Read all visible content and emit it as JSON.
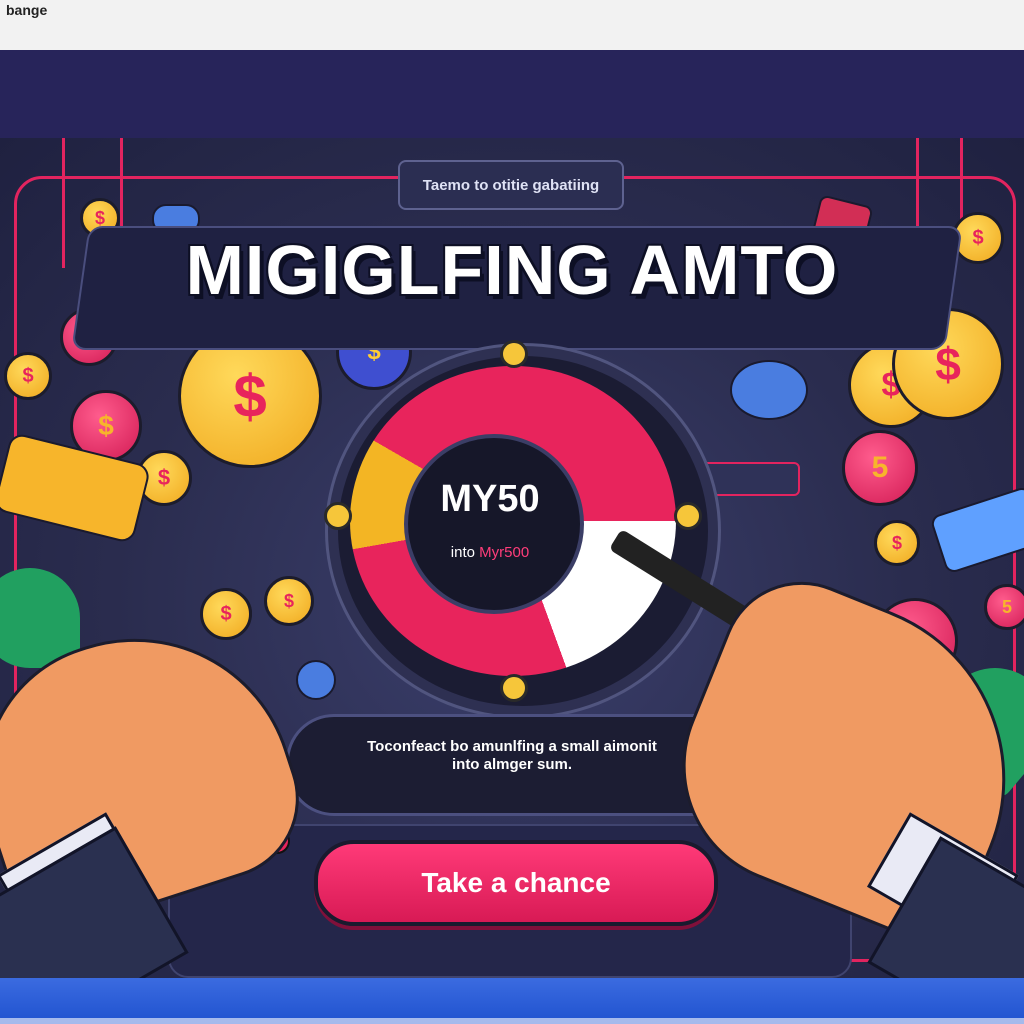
{
  "app": {
    "brand": "bange"
  },
  "hero": {
    "kicker": "Taemo to otitie gabatiing",
    "headline": "MIGIGLFING AMTO"
  },
  "wheel": {
    "amount": "MY50",
    "sub_prefix": "into ",
    "sub_highlight": "Myr500"
  },
  "info": {
    "line1": "Toconfeact bo amunlfing a small aimonit",
    "line2": "into almger sum."
  },
  "cta": {
    "label": "Take a chance"
  },
  "decor": {
    "coin_symbol": "$",
    "coin_five": "5",
    "coin_icon": "coin-icon",
    "colors": {
      "accent": "#e8245c",
      "gold": "#f3b524",
      "background": "#2a2c4e",
      "footer": "#2a5be0"
    }
  }
}
